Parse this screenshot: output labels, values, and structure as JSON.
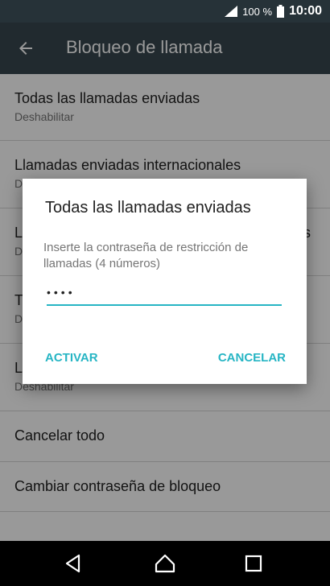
{
  "status_bar": {
    "battery_percent": "100 %",
    "time": "10:00",
    "icons": [
      "signal-icon",
      "battery-icon"
    ]
  },
  "app_bar": {
    "title": "Bloqueo de llamada",
    "back_icon": "arrow-back-icon"
  },
  "list": {
    "items": [
      {
        "primary": "Todas las llamadas enviadas",
        "secondary": "Deshabilitar"
      },
      {
        "primary": "Llamadas enviadas internacionales",
        "secondary": "D"
      },
      {
        "primary": "L",
        "primary_tail": "s",
        "secondary": "D"
      },
      {
        "primary": "T",
        "secondary": "D"
      },
      {
        "primary": "L",
        "secondary": "Deshabilitar"
      },
      {
        "primary": "Cancelar todo"
      },
      {
        "primary": "Cambiar contraseña de bloqueo"
      }
    ]
  },
  "dialog": {
    "title": "Todas las llamadas enviadas",
    "message": "Inserte la contraseña de restricción de llamadas (4 números)",
    "password_value": "••••",
    "activate_label": "ACTIVAR",
    "cancel_label": "CANCELAR"
  },
  "nav_bar": {
    "icons": [
      "back-triangle-icon",
      "home-icon",
      "recents-icon"
    ]
  },
  "colors": {
    "accent": "#26b5c4",
    "app_bar": "#37474f",
    "status_bar": "#263238"
  }
}
